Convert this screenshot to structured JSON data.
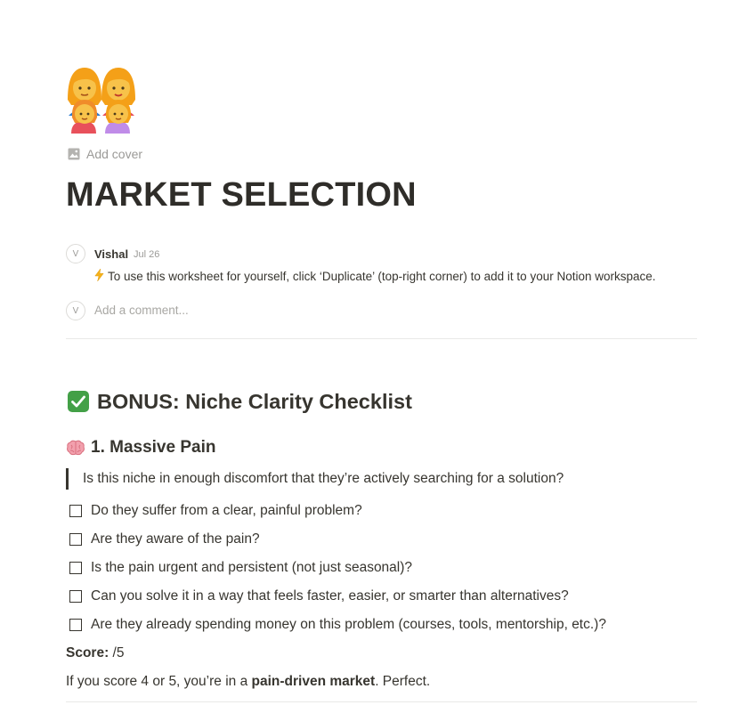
{
  "page": {
    "add_cover_label": "Add cover",
    "title": "MARKET SELECTION"
  },
  "comment": {
    "avatar_initial": "V",
    "author": "Vishal",
    "date": "Jul 26",
    "body": "To use this worksheet for yourself, click ‘Duplicate’ (top-right corner) to add it to your Notion workspace."
  },
  "new_comment": {
    "avatar_initial": "V",
    "placeholder": "Add a comment..."
  },
  "section": {
    "heading": "BONUS: Niche Clarity Checklist",
    "subheading": "1. Massive Pain",
    "quote": "Is this niche in enough discomfort that they’re actively searching for a solution?",
    "todos": [
      {
        "label": "Do they suffer from a clear, painful problem?",
        "checked": false
      },
      {
        "label": "Are they aware of the pain?",
        "checked": false
      },
      {
        "label": "Is the pain urgent and persistent (not just seasonal)?",
        "checked": false
      },
      {
        "label": "Can you solve it in a way that feels faster, easier, or smarter than alternatives?",
        "checked": false
      },
      {
        "label": "Are they already spending money on this problem (courses, tools, mentorship, etc.)?",
        "checked": false
      }
    ],
    "score_label": "Score:",
    "score_value": " /5",
    "result_prefix": "If you score 4 or 5, you’re in a ",
    "result_bold": "pain-driven market",
    "result_suffix": ". Perfect."
  },
  "icons": {
    "page_icon": "family-emoji-icon",
    "cover_icon": "image-icon",
    "bolt_icon": "lightning-icon",
    "heading_icon": "check-mark-button-icon",
    "subheading_icon": "brain-icon"
  },
  "colors": {
    "text": "#37352f",
    "muted": "#9b9a97",
    "divider": "#e9e9e7",
    "check_green": "#43a047"
  }
}
